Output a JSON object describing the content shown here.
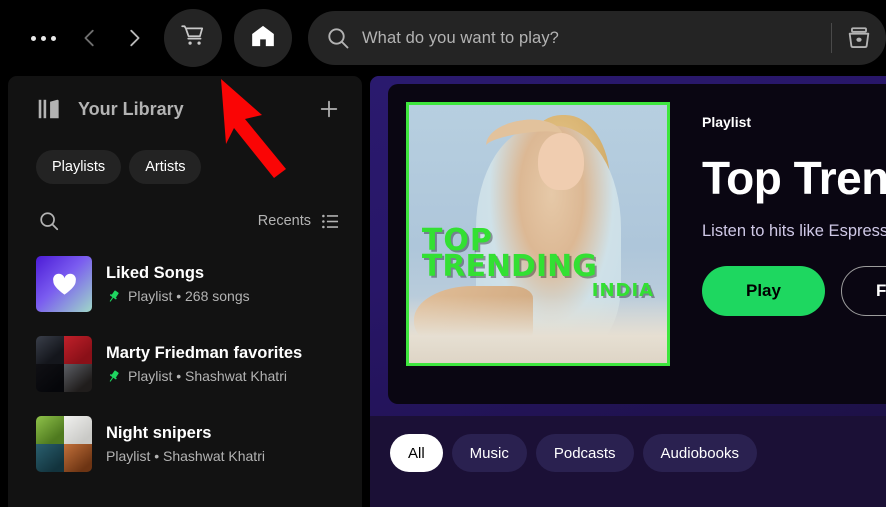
{
  "topbar": {
    "menu_label": "More options",
    "back_label": "Go back",
    "forward_label": "Go forward",
    "cart_label": "Cart",
    "home_label": "Home",
    "search_placeholder": "What do you want to play?",
    "browse_label": "Browse"
  },
  "sidebar": {
    "title": "Your Library",
    "add_label": "+",
    "chips": [
      {
        "label": "Playlists",
        "active": false
      },
      {
        "label": "Artists",
        "active": false
      }
    ],
    "search_label": "Search in Your Library",
    "sort_label": "Recents",
    "items": [
      {
        "title": "Liked Songs",
        "subtitle": "Playlist • 268 songs",
        "type": "Playlist",
        "meta": "268 songs",
        "pinned": true,
        "art": "heart-gradient"
      },
      {
        "title": "Marty Friedman favorites",
        "subtitle": "Playlist • Shashwat Khatri",
        "type": "Playlist",
        "meta": "Shashwat Khatri",
        "pinned": true,
        "art": "album-collage-dark"
      },
      {
        "title": "Night snipers",
        "subtitle": "Playlist • Shashwat Khatri",
        "type": "Playlist",
        "meta": "Shashwat Khatri",
        "pinned": false,
        "art": "album-collage-green"
      }
    ]
  },
  "main": {
    "hero": {
      "kind": "Playlist",
      "title": "Top Trending India",
      "description": "Listen to hits like Espresso here!",
      "play_label": "Play",
      "follow_label": "Follow",
      "cover": {
        "line1": "TOP",
        "line2": "TRENDING",
        "line3": "INDIA",
        "border_color": "#3ee63e",
        "text_color": "#33e033"
      }
    },
    "categories": [
      {
        "label": "All",
        "active": true
      },
      {
        "label": "Music",
        "active": false
      },
      {
        "label": "Podcasts",
        "active": false
      },
      {
        "label": "Audiobooks",
        "active": false
      }
    ]
  },
  "annotation": {
    "arrow_color": "#fa0505",
    "points_at": "cart-button"
  },
  "colors": {
    "page_bg": "#000000",
    "panel_bg": "#121212",
    "main_bg": "#1b1036",
    "accent_green": "#1ed760",
    "text_muted": "#b3b3b3"
  }
}
